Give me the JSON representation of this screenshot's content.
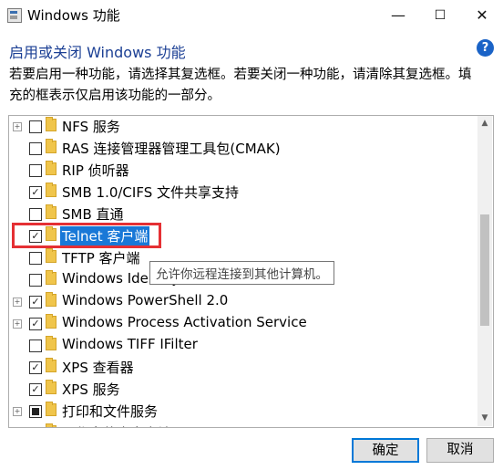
{
  "window": {
    "title": "Windows 功能",
    "controls": {
      "minimize": "—",
      "maximize": "☐",
      "close": "✕"
    }
  },
  "heading": "启用或关闭 Windows 功能",
  "help_label": "?",
  "description": "若要启用一种功能，请选择其复选框。若要关闭一种功能，请清除其复选框。填充的框表示仅启用该功能的一部分。",
  "features": [
    {
      "label": "NFS 服务",
      "checkbox": "unchecked",
      "expander": "+"
    },
    {
      "label": "RAS 连接管理器管理工具包(CMAK)",
      "checkbox": "unchecked",
      "expander": ""
    },
    {
      "label": "RIP 侦听器",
      "checkbox": "unchecked",
      "expander": ""
    },
    {
      "label": "SMB 1.0/CIFS 文件共享支持",
      "checkbox": "checked",
      "expander": ""
    },
    {
      "label": "SMB 直通",
      "checkbox": "unchecked",
      "expander": ""
    },
    {
      "label": "Telnet 客户端",
      "checkbox": "checked",
      "expander": "",
      "selected": true
    },
    {
      "label": "TFTP 客户端",
      "checkbox": "unchecked",
      "expander": ""
    },
    {
      "label": "Windows Identity Foundation 3.5",
      "checkbox": "unchecked",
      "expander": ""
    },
    {
      "label": "Windows PowerShell 2.0",
      "checkbox": "checked",
      "expander": "+"
    },
    {
      "label": "Windows Process Activation Service",
      "checkbox": "checked",
      "expander": "+"
    },
    {
      "label": "Windows TIFF IFilter",
      "checkbox": "unchecked",
      "expander": ""
    },
    {
      "label": "XPS 查看器",
      "checkbox": "checked",
      "expander": ""
    },
    {
      "label": "XPS 服务",
      "checkbox": "checked",
      "expander": ""
    },
    {
      "label": "打印和文件服务",
      "checkbox": "partial",
      "expander": "+"
    },
    {
      "label": "工作文件夹客户端",
      "checkbox": "unchecked",
      "expander": ""
    }
  ],
  "tooltip": "允许你远程连接到其他计算机。",
  "buttons": {
    "ok": "确定",
    "cancel": "取消"
  },
  "colors": {
    "selection": "#1978d7",
    "highlight_box": "#e53034",
    "heading": "#1b3f94"
  }
}
